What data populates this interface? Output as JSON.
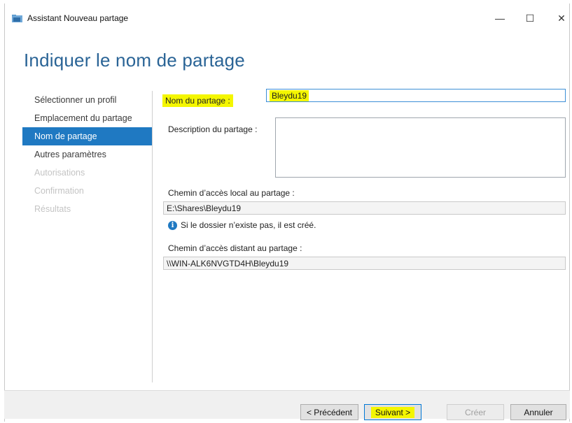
{
  "window": {
    "title": "Assistant Nouveau partage",
    "controls": {
      "minimize": "—",
      "maximize": "☐",
      "close": "✕"
    }
  },
  "page": {
    "heading": "Indiquer le nom de partage"
  },
  "nav": {
    "items": [
      {
        "label": "Sélectionner un profil",
        "state": "normal"
      },
      {
        "label": "Emplacement du partage",
        "state": "normal"
      },
      {
        "label": "Nom de partage",
        "state": "active"
      },
      {
        "label": "Autres paramètres",
        "state": "normal"
      },
      {
        "label": "Autorisations",
        "state": "disabled"
      },
      {
        "label": "Confirmation",
        "state": "disabled"
      },
      {
        "label": "Résultats",
        "state": "disabled"
      }
    ]
  },
  "form": {
    "share_name_label": "Nom du partage :",
    "share_name_value": "Bleydu19",
    "description_label": "Description du partage :",
    "description_value": "",
    "local_path_label": "Chemin d’accès local au partage :",
    "local_path_value": "E:\\Shares\\Bleydu19",
    "info_text": "Si le dossier n’existe pas, il est créé.",
    "remote_path_label": "Chemin d’accès distant au partage :",
    "remote_path_value": "\\\\WIN-ALK6NVGTD4H\\Bleydu19"
  },
  "buttons": {
    "previous": "< Précédent",
    "next": "Suivant >",
    "create": "Créer",
    "cancel": "Annuler"
  },
  "colors": {
    "accent": "#1f79c2",
    "heading": "#2a6496",
    "highlight": "#f4f600"
  }
}
